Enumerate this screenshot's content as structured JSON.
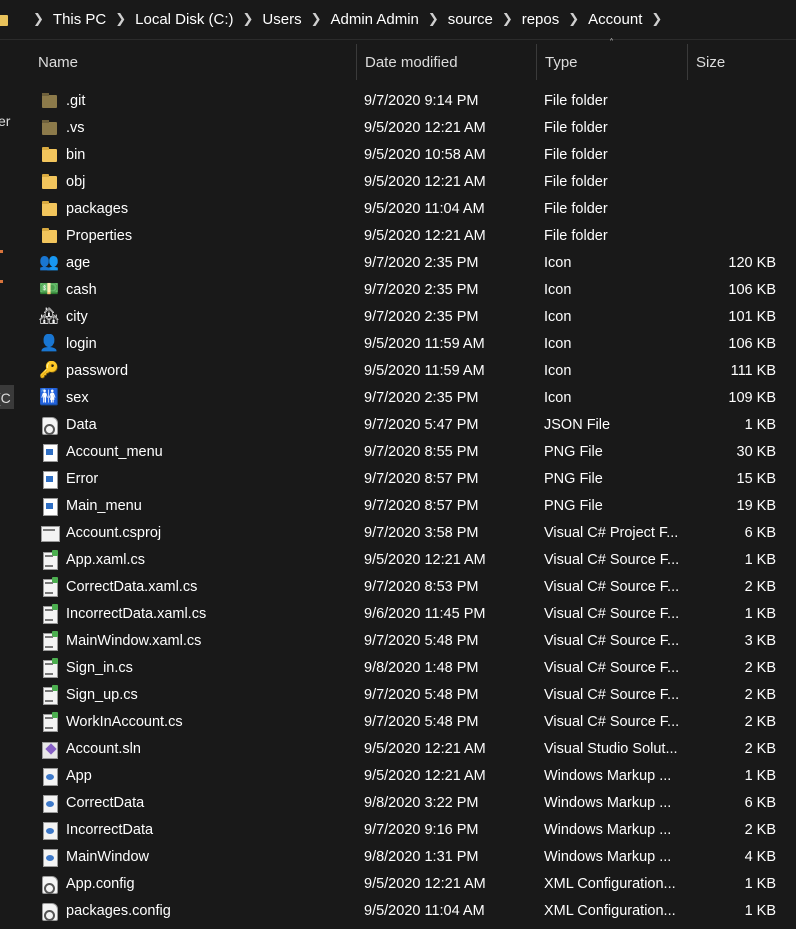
{
  "address_bar": {
    "crumbs": [
      "This PC",
      "Local Disk (C:)",
      "Users",
      "Admin Admin",
      "source",
      "repos",
      "Account"
    ]
  },
  "nav_fragments": {
    "item1": "er",
    "item2": "(C"
  },
  "columns": {
    "name": "Name",
    "date": "Date modified",
    "type": "Type",
    "size": "Size"
  },
  "colors": {
    "background": "#191919",
    "folder": "#f2c55c",
    "text": "#ffffff"
  },
  "files": [
    {
      "name": ".git",
      "date": "9/7/2020 9:14 PM",
      "type": "File folder",
      "size": "",
      "icon": "folder-icon"
    },
    {
      "name": ".vs",
      "date": "9/5/2020 12:21 AM",
      "type": "File folder",
      "size": "",
      "icon": "folder-icon"
    },
    {
      "name": "bin",
      "date": "9/5/2020 10:58 AM",
      "type": "File folder",
      "size": "",
      "icon": "folder-icon"
    },
    {
      "name": "obj",
      "date": "9/5/2020 12:21 AM",
      "type": "File folder",
      "size": "",
      "icon": "folder-icon"
    },
    {
      "name": "packages",
      "date": "9/5/2020 11:04 AM",
      "type": "File folder",
      "size": "",
      "icon": "folder-icon"
    },
    {
      "name": "Properties",
      "date": "9/5/2020 12:21 AM",
      "type": "File folder",
      "size": "",
      "icon": "folder-icon"
    },
    {
      "name": "age",
      "date": "9/7/2020 2:35 PM",
      "type": "Icon",
      "size": "120 KB",
      "icon": "people-icon"
    },
    {
      "name": "cash",
      "date": "9/7/2020 2:35 PM",
      "type": "Icon",
      "size": "106 KB",
      "icon": "money-icon"
    },
    {
      "name": "city",
      "date": "9/7/2020 2:35 PM",
      "type": "Icon",
      "size": "101 KB",
      "icon": "city-icon"
    },
    {
      "name": "login",
      "date": "9/5/2020 11:59 AM",
      "type": "Icon",
      "size": "106 KB",
      "icon": "user-lock-icon"
    },
    {
      "name": "password",
      "date": "9/5/2020 11:59 AM",
      "type": "Icon",
      "size": "111 KB",
      "icon": "key-icon"
    },
    {
      "name": "sex",
      "date": "9/7/2020 2:35 PM",
      "type": "Icon",
      "size": "109 KB",
      "icon": "gender-icon"
    },
    {
      "name": "Data",
      "date": "9/7/2020 5:47 PM",
      "type": "JSON File",
      "size": "1 KB",
      "icon": "json-file-icon"
    },
    {
      "name": "Account_menu",
      "date": "9/7/2020 8:55 PM",
      "type": "PNG File",
      "size": "30 KB",
      "icon": "image-file-icon"
    },
    {
      "name": "Error",
      "date": "9/7/2020 8:57 PM",
      "type": "PNG File",
      "size": "15 KB",
      "icon": "image-file-icon"
    },
    {
      "name": "Main_menu",
      "date": "9/7/2020 8:57 PM",
      "type": "PNG File",
      "size": "19 KB",
      "icon": "image-file-icon"
    },
    {
      "name": "Account.csproj",
      "date": "9/7/2020 3:58 PM",
      "type": "Visual C# Project F...",
      "size": "6 KB",
      "icon": "csproj-file-icon"
    },
    {
      "name": "App.xaml.cs",
      "date": "9/5/2020 12:21 AM",
      "type": "Visual C# Source F...",
      "size": "1 KB",
      "icon": "cs-file-icon"
    },
    {
      "name": "CorrectData.xaml.cs",
      "date": "9/7/2020 8:53 PM",
      "type": "Visual C# Source F...",
      "size": "2 KB",
      "icon": "cs-file-icon"
    },
    {
      "name": "IncorrectData.xaml.cs",
      "date": "9/6/2020 11:45 PM",
      "type": "Visual C# Source F...",
      "size": "1 KB",
      "icon": "cs-file-icon"
    },
    {
      "name": "MainWindow.xaml.cs",
      "date": "9/7/2020 5:48 PM",
      "type": "Visual C# Source F...",
      "size": "3 KB",
      "icon": "cs-file-icon"
    },
    {
      "name": "Sign_in.cs",
      "date": "9/8/2020 1:48 PM",
      "type": "Visual C# Source F...",
      "size": "2 KB",
      "icon": "cs-file-icon"
    },
    {
      "name": "Sign_up.cs",
      "date": "9/7/2020 5:48 PM",
      "type": "Visual C# Source F...",
      "size": "2 KB",
      "icon": "cs-file-icon"
    },
    {
      "name": "WorkInAccount.cs",
      "date": "9/7/2020 5:48 PM",
      "type": "Visual C# Source F...",
      "size": "2 KB",
      "icon": "cs-file-icon"
    },
    {
      "name": "Account.sln",
      "date": "9/5/2020 12:21 AM",
      "type": "Visual Studio Solut...",
      "size": "2 KB",
      "icon": "sln-file-icon"
    },
    {
      "name": "App",
      "date": "9/5/2020 12:21 AM",
      "type": "Windows Markup ...",
      "size": "1 KB",
      "icon": "xaml-file-icon"
    },
    {
      "name": "CorrectData",
      "date": "9/8/2020 3:22 PM",
      "type": "Windows Markup ...",
      "size": "6 KB",
      "icon": "xaml-file-icon"
    },
    {
      "name": "IncorrectData",
      "date": "9/7/2020 9:16 PM",
      "type": "Windows Markup ...",
      "size": "2 KB",
      "icon": "xaml-file-icon"
    },
    {
      "name": "MainWindow",
      "date": "9/8/2020 1:31 PM",
      "type": "Windows Markup ...",
      "size": "4 KB",
      "icon": "xaml-file-icon"
    },
    {
      "name": "App.config",
      "date": "9/5/2020 12:21 AM",
      "type": "XML Configuration...",
      "size": "1 KB",
      "icon": "config-file-icon"
    },
    {
      "name": "packages.config",
      "date": "9/5/2020 11:04 AM",
      "type": "XML Configuration...",
      "size": "1 KB",
      "icon": "config-file-icon"
    }
  ]
}
